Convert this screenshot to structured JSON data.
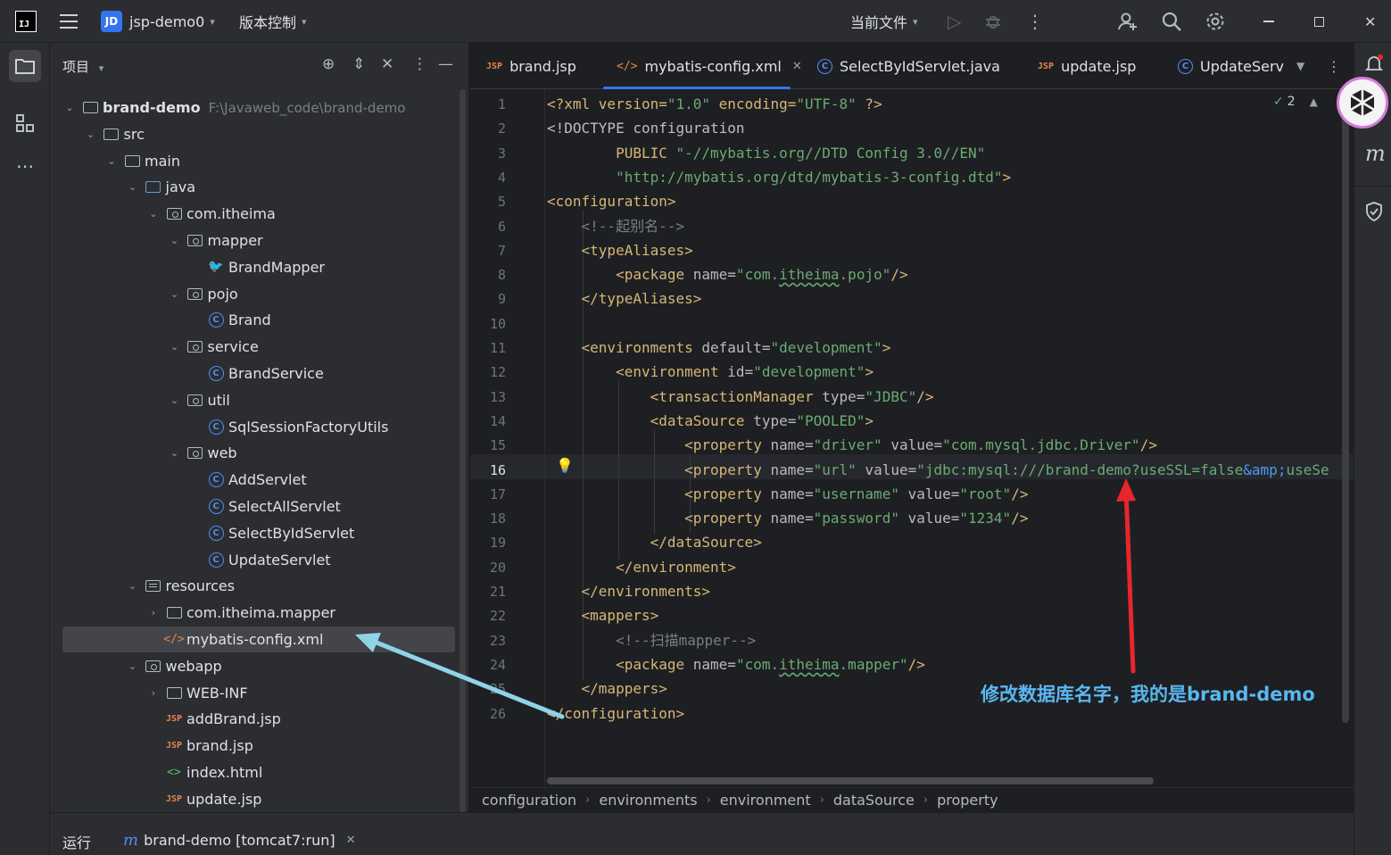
{
  "titlebar": {
    "project_badge": "JD",
    "project_name": "jsp-demo0",
    "vcs_label": "版本控制",
    "run_config": "当前文件"
  },
  "project_panel": {
    "title": "项目",
    "tree": [
      {
        "label": "brand-demo",
        "path": "F:\\Javaweb_code\\brand-demo",
        "icon": "folder-icon",
        "depth": 0,
        "arrow": "open"
      },
      {
        "label": "src",
        "icon": "folder-icon",
        "depth": 1,
        "arrow": "open"
      },
      {
        "label": "main",
        "icon": "folder-icon",
        "depth": 2,
        "arrow": "open"
      },
      {
        "label": "java",
        "icon": "source-folder-icon",
        "depth": 3,
        "arrow": "open"
      },
      {
        "label": "com.itheima",
        "icon": "package-icon",
        "depth": 4,
        "arrow": "open"
      },
      {
        "label": "mapper",
        "icon": "package-icon",
        "depth": 5,
        "arrow": "open"
      },
      {
        "label": "BrandMapper",
        "icon": "mapper-icon",
        "depth": 6,
        "arrow": "none"
      },
      {
        "label": "pojo",
        "icon": "package-icon",
        "depth": 5,
        "arrow": "open"
      },
      {
        "label": "Brand",
        "icon": "class-icon",
        "depth": 6,
        "arrow": "none"
      },
      {
        "label": "service",
        "icon": "package-icon",
        "depth": 5,
        "arrow": "open"
      },
      {
        "label": "BrandService",
        "icon": "class-icon",
        "depth": 6,
        "arrow": "none"
      },
      {
        "label": "util",
        "icon": "package-icon",
        "depth": 5,
        "arrow": "open"
      },
      {
        "label": "SqlSessionFactoryUtils",
        "icon": "class-icon",
        "depth": 6,
        "arrow": "none"
      },
      {
        "label": "web",
        "icon": "package-icon",
        "depth": 5,
        "arrow": "open"
      },
      {
        "label": "AddServlet",
        "icon": "class-icon",
        "depth": 6,
        "arrow": "none"
      },
      {
        "label": "SelectAllServlet",
        "icon": "class-icon",
        "depth": 6,
        "arrow": "none"
      },
      {
        "label": "SelectByIdServlet",
        "icon": "class-icon",
        "depth": 6,
        "arrow": "none"
      },
      {
        "label": "UpdateServlet",
        "icon": "class-icon",
        "depth": 6,
        "arrow": "none"
      },
      {
        "label": "resources",
        "icon": "resources-folder-icon",
        "depth": 3,
        "arrow": "open"
      },
      {
        "label": "com.itheima.mapper",
        "icon": "folder-icon",
        "depth": 4,
        "arrow": "closed"
      },
      {
        "label": "mybatis-config.xml",
        "icon": "xml-icon",
        "depth": 4,
        "arrow": "none",
        "selected": true
      },
      {
        "label": "webapp",
        "icon": "package-icon",
        "depth": 3,
        "arrow": "open"
      },
      {
        "label": "WEB-INF",
        "icon": "folder-icon",
        "depth": 4,
        "arrow": "closed"
      },
      {
        "label": "addBrand.jsp",
        "icon": "jsp-icon",
        "depth": 4,
        "arrow": "none"
      },
      {
        "label": "brand.jsp",
        "icon": "jsp-icon",
        "depth": 4,
        "arrow": "none"
      },
      {
        "label": "index.html",
        "icon": "html-icon",
        "depth": 4,
        "arrow": "none"
      },
      {
        "label": "update.jsp",
        "icon": "jsp-icon",
        "depth": 4,
        "arrow": "none"
      }
    ]
  },
  "editor": {
    "tabs": [
      {
        "label": "brand.jsp",
        "icon": "jsp-icon"
      },
      {
        "label": "mybatis-config.xml",
        "icon": "xml-icon",
        "active": true
      },
      {
        "label": "SelectByIdServlet.java",
        "icon": "class-icon"
      },
      {
        "label": "update.jsp",
        "icon": "jsp-icon"
      },
      {
        "label": "UpdateServ",
        "icon": "class-icon"
      }
    ],
    "inspection_count": "2",
    "current_line": "16",
    "line_numbers": [
      "1",
      "2",
      "3",
      "4",
      "5",
      "6",
      "7",
      "8",
      "9",
      "10",
      "11",
      "12",
      "13",
      "14",
      "15",
      "16",
      "17",
      "18",
      "19",
      "20",
      "21",
      "22",
      "23",
      "24",
      "25",
      "26"
    ],
    "lines": [
      [
        {
          "t": "<?xml version=",
          "c": "tag"
        },
        {
          "t": "\"1.0\"",
          "c": "str"
        },
        {
          "t": " encoding=",
          "c": "tag"
        },
        {
          "t": "\"UTF-8\"",
          "c": "str"
        },
        {
          "t": " ?>",
          "c": "tag"
        }
      ],
      [
        {
          "t": "<!DOCTYPE configuration",
          "c": "plain"
        }
      ],
      [
        {
          "t": "        PUBLIC ",
          "c": "tag"
        },
        {
          "t": "\"-//mybatis.org//DTD Config 3.0//EN\"",
          "c": "str"
        }
      ],
      [
        {
          "t": "        ",
          "c": "plain"
        },
        {
          "t": "\"http://mybatis.org/dtd/mybatis-3-config.dtd\"",
          "c": "str"
        },
        {
          "t": ">",
          "c": "tag"
        }
      ],
      [
        {
          "t": "<configuration>",
          "c": "tag"
        }
      ],
      [
        {
          "t": "    ",
          "c": "plain"
        },
        {
          "t": "<!--起别名-->",
          "c": "cmt"
        }
      ],
      [
        {
          "t": "    <typeAliases>",
          "c": "tag"
        }
      ],
      [
        {
          "t": "        <package ",
          "c": "tag"
        },
        {
          "t": "name=",
          "c": "attr"
        },
        {
          "t": "\"com.",
          "c": "str"
        },
        {
          "t": "itheima",
          "c": "str und"
        },
        {
          "t": ".pojo\"",
          "c": "str"
        },
        {
          "t": "/>",
          "c": "tag"
        }
      ],
      [
        {
          "t": "    </typeAliases>",
          "c": "tag"
        }
      ],
      [],
      [
        {
          "t": "    <environments ",
          "c": "tag"
        },
        {
          "t": "default=",
          "c": "attr"
        },
        {
          "t": "\"development\"",
          "c": "str"
        },
        {
          "t": ">",
          "c": "tag"
        }
      ],
      [
        {
          "t": "        <environment ",
          "c": "tag"
        },
        {
          "t": "id=",
          "c": "attr"
        },
        {
          "t": "\"development\"",
          "c": "str"
        },
        {
          "t": ">",
          "c": "tag"
        }
      ],
      [
        {
          "t": "            <transactionManager ",
          "c": "tag"
        },
        {
          "t": "type=",
          "c": "attr"
        },
        {
          "t": "\"JDBC\"",
          "c": "str"
        },
        {
          "t": "/>",
          "c": "tag"
        }
      ],
      [
        {
          "t": "            <dataSource ",
          "c": "tag"
        },
        {
          "t": "type=",
          "c": "attr"
        },
        {
          "t": "\"POOLED\"",
          "c": "str"
        },
        {
          "t": ">",
          "c": "tag"
        }
      ],
      [
        {
          "t": "                <property ",
          "c": "tag"
        },
        {
          "t": "name=",
          "c": "attr"
        },
        {
          "t": "\"driver\"",
          "c": "str"
        },
        {
          "t": " value=",
          "c": "attr"
        },
        {
          "t": "\"com.mysql.jdbc.Driver\"",
          "c": "str"
        },
        {
          "t": "/>",
          "c": "tag"
        }
      ],
      [
        {
          "t": "                <property ",
          "c": "tag"
        },
        {
          "t": "name=",
          "c": "attr"
        },
        {
          "t": "\"url\"",
          "c": "str"
        },
        {
          "t": " value=",
          "c": "attr"
        },
        {
          "t": "\"jdbc:mysql:///brand-demo?useSSL=false",
          "c": "str"
        },
        {
          "t": "&amp;",
          "c": "ent"
        },
        {
          "t": "useSe",
          "c": "str"
        }
      ],
      [
        {
          "t": "                <property ",
          "c": "tag"
        },
        {
          "t": "name=",
          "c": "attr"
        },
        {
          "t": "\"username\"",
          "c": "str"
        },
        {
          "t": " value=",
          "c": "attr"
        },
        {
          "t": "\"root\"",
          "c": "str"
        },
        {
          "t": "/>",
          "c": "tag"
        }
      ],
      [
        {
          "t": "                <property ",
          "c": "tag"
        },
        {
          "t": "name=",
          "c": "attr"
        },
        {
          "t": "\"password\"",
          "c": "str"
        },
        {
          "t": " value=",
          "c": "attr"
        },
        {
          "t": "\"1234\"",
          "c": "str"
        },
        {
          "t": "/>",
          "c": "tag"
        }
      ],
      [
        {
          "t": "            </dataSource>",
          "c": "tag"
        }
      ],
      [
        {
          "t": "        </environment>",
          "c": "tag"
        }
      ],
      [
        {
          "t": "    </environments>",
          "c": "tag"
        }
      ],
      [
        {
          "t": "    <mappers>",
          "c": "tag"
        }
      ],
      [
        {
          "t": "        ",
          "c": "plain"
        },
        {
          "t": "<!--扫描mapper-->",
          "c": "cmt"
        }
      ],
      [
        {
          "t": "        <package ",
          "c": "tag"
        },
        {
          "t": "name=",
          "c": "attr"
        },
        {
          "t": "\"com.",
          "c": "str"
        },
        {
          "t": "itheima",
          "c": "str und"
        },
        {
          "t": ".mapper\"",
          "c": "str"
        },
        {
          "t": "/>",
          "c": "tag"
        }
      ],
      [
        {
          "t": "    </mappers>",
          "c": "tag"
        }
      ],
      [
        {
          "t": "</configuration>",
          "c": "tag"
        }
      ]
    ],
    "breadcrumb": [
      "configuration",
      "environments",
      "environment",
      "dataSource",
      "property"
    ]
  },
  "run_bar": {
    "label": "运行",
    "tab": "brand-demo [tomcat7:run]"
  },
  "annotation": {
    "note": "修改数据库名字，我的是brand-demo",
    "note_color": "#59b7f0",
    "red_arrow_color": "#e8262b",
    "blue_arrow_color": "#8fd3e8"
  },
  "colors": {
    "accent": "#3574f0",
    "tag": "#d5b778",
    "string": "#6aab73",
    "comment": "#7a7e85"
  }
}
